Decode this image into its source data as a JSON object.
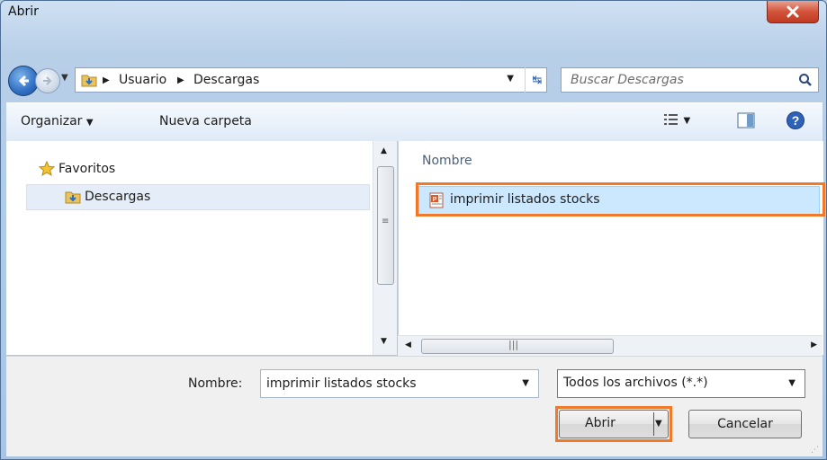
{
  "window": {
    "title": "Abrir"
  },
  "address": {
    "crumbs": [
      "Usuario",
      "Descargas"
    ],
    "search_placeholder": "Buscar Descargas"
  },
  "toolbar": {
    "organize": "Organizar",
    "new_folder": "Nueva carpeta"
  },
  "nav_pane": {
    "favorites": "Favoritos",
    "items": [
      {
        "label": "Descargas",
        "selected": true
      }
    ]
  },
  "file_list": {
    "column_name": "Nombre",
    "files": [
      {
        "name": "imprimir listados stocks",
        "type": "powerpoint",
        "selected": true
      }
    ]
  },
  "bottom": {
    "filename_label": "Nombre:",
    "filename_value": "imprimir listados stocks",
    "filter_value": "Todos los archivos (*.*)",
    "open_label": "Abrir",
    "cancel_label": "Cancelar"
  },
  "colors": {
    "highlight": "#f07a2a",
    "selection": "#cce8ff"
  }
}
